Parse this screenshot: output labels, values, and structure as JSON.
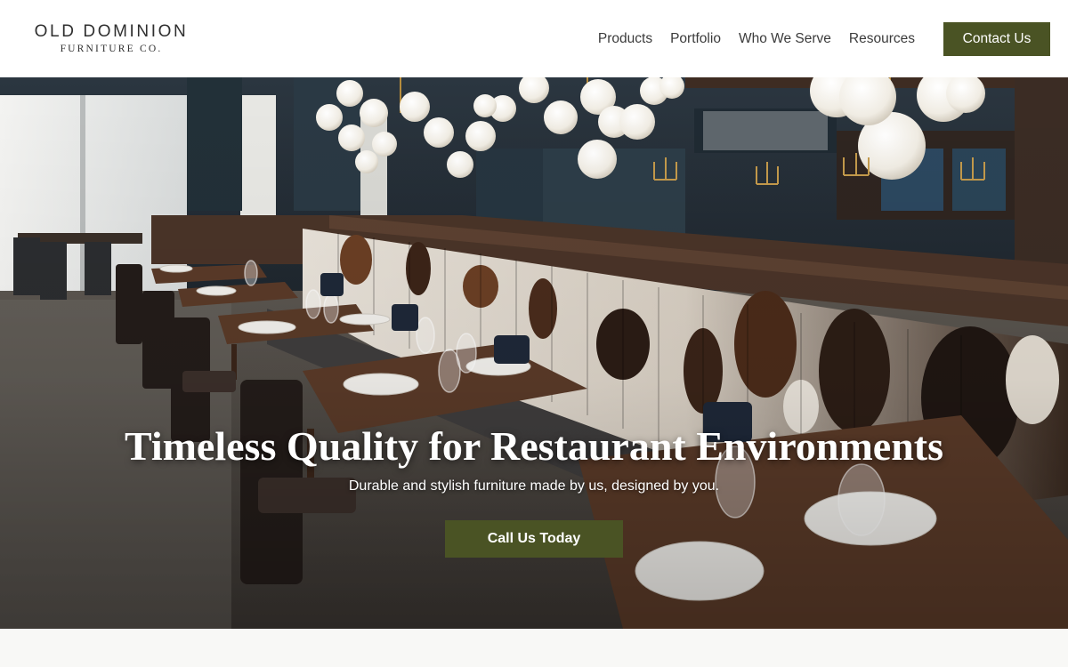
{
  "brand": {
    "name": "OLD DOMINION",
    "tagline": "FURNITURE CO."
  },
  "nav": {
    "items": [
      {
        "label": "Products"
      },
      {
        "label": "Portfolio"
      },
      {
        "label": "Who We Serve"
      },
      {
        "label": "Resources"
      }
    ],
    "contact_label": "Contact Us"
  },
  "hero": {
    "image": "restaurant-interior-photo",
    "title": "Timeless Quality for Restaurant Environments",
    "subtitle": "Durable and stylish furniture made by us, designed by you.",
    "cta_label": "Call Us Today"
  },
  "colors": {
    "accent": "#4a5324",
    "header_bg": "#ffffff",
    "text": "#333333"
  }
}
